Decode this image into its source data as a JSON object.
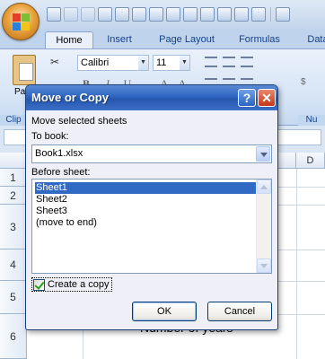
{
  "ribbon": {
    "tabs": [
      "Home",
      "Insert",
      "Page Layout",
      "Formulas",
      "Data"
    ],
    "active_tab": "Home",
    "font_name": "Calibri",
    "font_size": "11",
    "paste_label": "Pa",
    "group_labels": [
      "Clip",
      "Nu"
    ]
  },
  "grid": {
    "columns": [
      "D"
    ],
    "rows": [
      "1",
      "2",
      "3",
      "4",
      "5",
      "6"
    ],
    "cell_text": "Number of years"
  },
  "dialog": {
    "title": "Move or Copy",
    "instruction": "Move selected sheets",
    "to_book_label": "To book:",
    "to_book_value": "Book1.xlsx",
    "before_sheet_label": "Before sheet:",
    "sheets": [
      "Sheet1",
      "Sheet2",
      "Sheet3",
      "(move to end)"
    ],
    "selected_sheet": "Sheet1",
    "create_copy_label": "Create a copy",
    "create_copy_checked": true,
    "ok_label": "OK",
    "cancel_label": "Cancel",
    "help_glyph": "?",
    "close_glyph": "✕"
  }
}
